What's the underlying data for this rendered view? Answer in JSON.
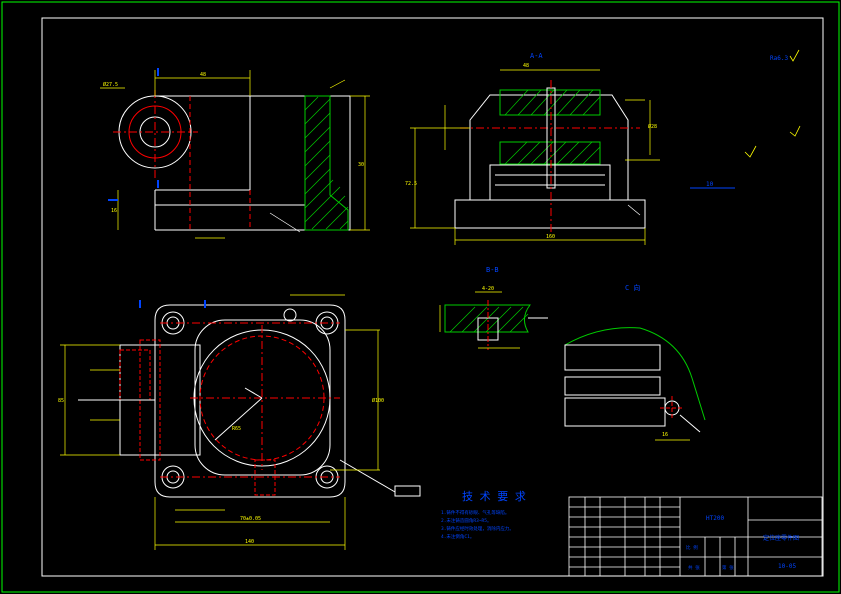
{
  "colors": {
    "background": "#000000",
    "outline": "#ffffff",
    "border": "#00ff00",
    "center_line": "#ff0000",
    "dimension": "#ffff00",
    "hatch": "#00cc00",
    "annotation": "#0044ff",
    "title_block_text": "#ffffff"
  },
  "views": {
    "section_aa_label": "A-A",
    "section_bb_label": "B-B",
    "view_c_label": "C 向"
  },
  "roughness": {
    "general_symbol": "Ra6.3"
  },
  "technical_requirements": {
    "title": "技 术 要 求",
    "items": [
      "1.铸件不得有砂眼、气孔等缺陷。",
      "2.未注铸造圆角R3~R5。",
      "3.铸件应经时效处理，消除内应力。",
      "4.未注倒角C1。"
    ]
  },
  "title_block": {
    "material": "HT200",
    "part_name": "定位座零件图",
    "drawing_no": "10-05",
    "scale_label": "比 例",
    "sheet_label": "共 张",
    "qty_label": "第 张"
  },
  "dimensions": {
    "top_width": "48",
    "top_diameter": "Ø27.5",
    "top_height": "30",
    "side_height": "16",
    "aa_width": "48",
    "aa_total": "160",
    "aa_height": "72.5",
    "aa_hole": "Ø28",
    "plan_width": "140",
    "plan_mid": "70±0.05",
    "plan_height": "85",
    "plan_circle": "Ø100",
    "plan_radius": "R65",
    "bb_width": "4-20",
    "c_dim": "16"
  }
}
